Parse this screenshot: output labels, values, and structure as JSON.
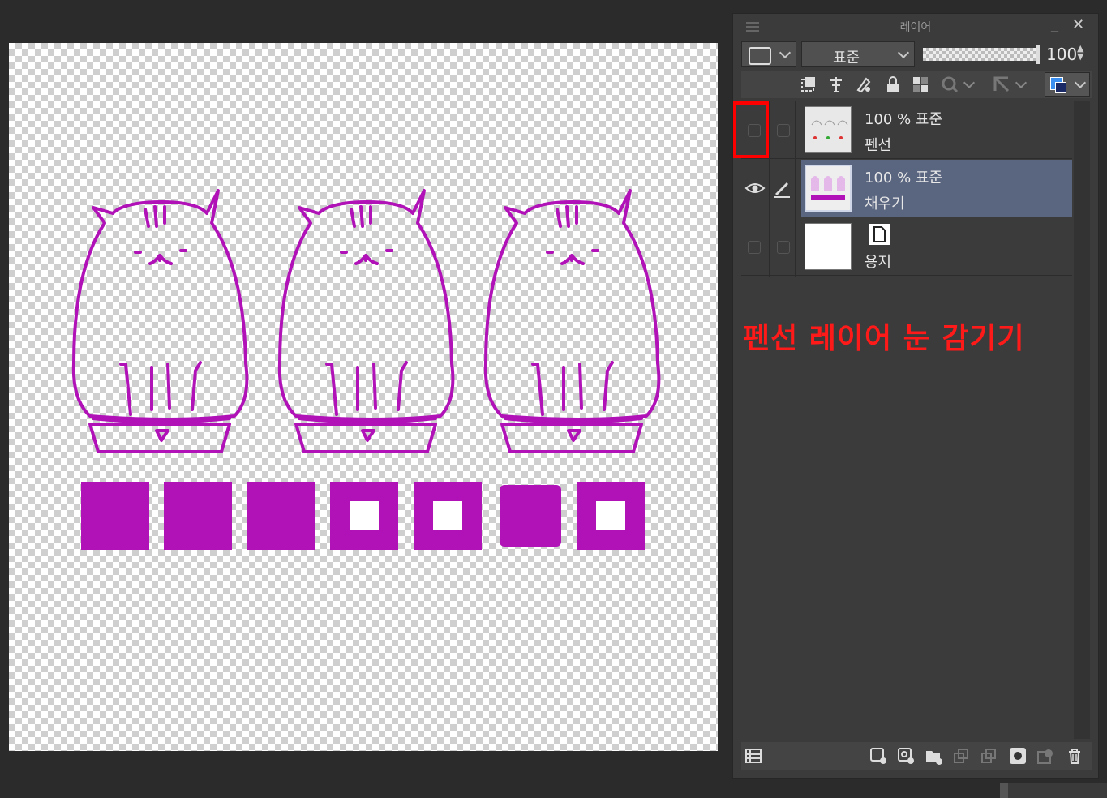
{
  "panel": {
    "title": "레이어",
    "minimize_icon": "minimize-icon",
    "close_icon": "close-icon",
    "blend_mode": "표준",
    "opacity": "100"
  },
  "layers": [
    {
      "opacity_mode": "100 % 표준",
      "name": "펜선",
      "visible": false,
      "selected": false
    },
    {
      "opacity_mode": "100 % 표준",
      "name": "채우기",
      "visible": true,
      "selected": true
    },
    {
      "opacity_mode": "",
      "name": "용지",
      "visible": false,
      "selected": false
    }
  ],
  "annotation": "펜선 레이어 눈 감기기",
  "colors": {
    "accent": "#b012b8",
    "highlight": "#ff0000",
    "selected_layer": "#5a6580"
  },
  "swatches": [
    {
      "type": "filled"
    },
    {
      "type": "filled"
    },
    {
      "type": "filled"
    },
    {
      "type": "hollow"
    },
    {
      "type": "hollow"
    },
    {
      "type": "rounded"
    },
    {
      "type": "hollow"
    }
  ]
}
